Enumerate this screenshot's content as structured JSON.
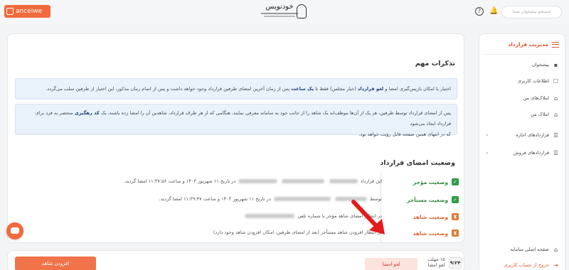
{
  "header": {
    "brand_text": "anceiwe",
    "logo_text": "خودنویس",
    "help_glyph": "?",
    "bell_glyph": "🔔",
    "search_placeholder": "جستجو پیشخوان شما"
  },
  "notes": {
    "title": "تذکرات مهم",
    "box1_pre": "اختیار یا امکان بازپس‌گیری امضا و ",
    "box1_bold1": "لغو قرارداد",
    "box1_mid": " (خیار مجلس) فقط تا ",
    "box1_bold2": "یک ساعت",
    "box1_post": " پس از زمان آخرین امضای طرفین قرارداد وجود خواهد داشت و پس از اتمام زمان مذکور، این اختیار از طرفین سلب می‌گردد.",
    "box2_line1": "پس از امضای قرارداد توسط طرفین، هر یک از آن‌ها موظف‌اند یک شاهد را از جانب خود به سامانه معرفی نمایند. هنگامی که از هر طرف قرارداد، شاهدین آن را امضا زده باشند، یک ",
    "box2_bold": "کد رهگیری",
    "box2_line1_end": " منحصر به فرد برای قرارداد ایجاد می‌شود",
    "box2_line2": "که در انتهای همین صفحه قابل رؤیت خواهد بود."
  },
  "signatures": {
    "title": "وضعیت امضای قرارداد",
    "rows": [
      {
        "label": "وضعیت مؤجر",
        "icon": "✓",
        "pre": "این قرارداد",
        "post": "در تاریخ ۱۱ شهریور ۱۴۰۳ و ساعت ۱۱:۳۷:۵۶ امضا گردید."
      },
      {
        "label": "وضعیت مستأجر",
        "icon": "✓",
        "pre": "توسط",
        "post": "در تاریخ ۱۱ شهریور ۱۴۰۳ و ساعت ۱۱:۳۹:۴۷ امضا گردید."
      },
      {
        "label": "وضعیت شاهد",
        "icon": "⧗",
        "text": "در انتظار امضای شاهد مؤجر با شماره تلفن"
      },
      {
        "label": "وضعیت شاهد",
        "icon": "⧗",
        "text": "در انتظار افزودن شاهد مستأجر (بعد از امضای طرفین، امکان افزودن شاهد وجود دارد)"
      }
    ]
  },
  "sidebar": {
    "title": "مدیریت قرارداد",
    "items": [
      {
        "label": "پیشخوان",
        "icon": "▪"
      },
      {
        "label": "اطلاعات کاربری",
        "icon": "☐"
      },
      {
        "label": "املاک‌های من",
        "icon": "⌂"
      },
      {
        "label": "املاک من",
        "icon": "⌂"
      },
      {
        "label": "قراردادهای اجاره",
        "icon": "☰"
      },
      {
        "label": "قراردادهای فروش",
        "icon": "☰"
      },
      {
        "label": "صفحه اصلی سامانه",
        "icon": "⌂"
      },
      {
        "label": "خروج از حساب کاربری",
        "icon": "⇥"
      }
    ]
  },
  "bottom": {
    "add_witness": "افزودن شاهد",
    "cancel_sign": "لغو امضا",
    "deadline_line1": "مهلت",
    "deadline_line2": "لغو امضا",
    "deadline_prefix": "۱۵",
    "timer": "۹:۲۴"
  }
}
